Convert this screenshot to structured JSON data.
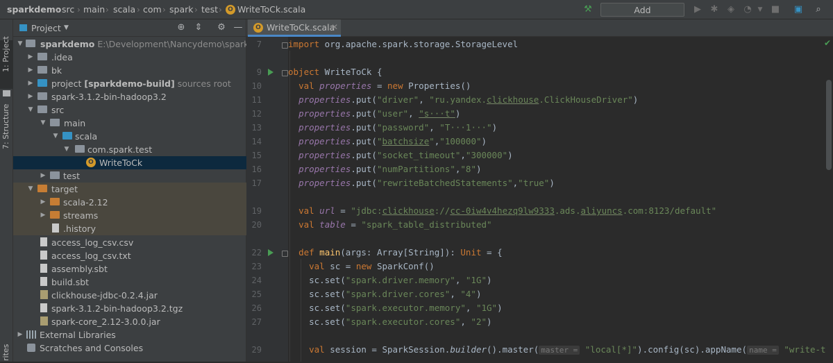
{
  "breadcrumbs": [
    "sparkdemo",
    "src",
    "main",
    "scala",
    "com",
    "spark",
    "test",
    "WriteToCk.scala"
  ],
  "toolbar": {
    "add_configuration": "Add Configuration..."
  },
  "left_strip": {
    "project_tab": "1: Project",
    "structure_tab": "7: Structure",
    "bottom_tab": "rites"
  },
  "project_panel": {
    "title": "Project",
    "tree": [
      {
        "label": "sparkdemo",
        "suffix": "E:\\Development\\Nancydemo\\sparkdemo",
        "icon": "module-folder-icon"
      },
      {
        "label": ".idea",
        "icon": "folder-icon"
      },
      {
        "label": "bk",
        "icon": "folder-icon"
      },
      {
        "label": "project",
        "bold": "[sparkdemo-build]",
        "suffix": "sources root",
        "icon": "blue-folder-icon"
      },
      {
        "label": "spark-3.1.2-bin-hadoop3.2",
        "icon": "folder-icon"
      },
      {
        "label": "src",
        "icon": "folder-icon"
      },
      {
        "label": "main",
        "icon": "folder-icon"
      },
      {
        "label": "scala",
        "icon": "blue-folder-icon"
      },
      {
        "label": "com.spark.test",
        "icon": "package-icon"
      },
      {
        "label": "WriteToCk",
        "icon": "scala-object-icon"
      },
      {
        "label": "test",
        "icon": "folder-icon"
      },
      {
        "label": "target",
        "icon": "excluded-folder-icon"
      },
      {
        "label": "scala-2.12",
        "icon": "excluded-folder-icon"
      },
      {
        "label": "streams",
        "icon": "excluded-folder-icon"
      },
      {
        "label": ".history",
        "icon": "file-icon"
      },
      {
        "label": "access_log_csv.csv",
        "icon": "file-icon"
      },
      {
        "label": "access_log_csv.txt",
        "icon": "file-icon"
      },
      {
        "label": "assembly.sbt",
        "icon": "file-icon"
      },
      {
        "label": "build.sbt",
        "icon": "file-icon"
      },
      {
        "label": "clickhouse-jdbc-0.2.4.jar",
        "icon": "jar-icon"
      },
      {
        "label": "spark-3.1.2-bin-hadoop3.2.tgz",
        "icon": "file-icon"
      },
      {
        "label": "spark-core_2.12-3.0.0.jar",
        "icon": "jar-icon"
      },
      {
        "label": "External Libraries",
        "icon": "library-icon"
      },
      {
        "label": "Scratches and Consoles",
        "icon": "scratches-icon"
      }
    ]
  },
  "editor": {
    "tab_label": "WriteToCk.scala",
    "line_numbers": [
      "7",
      "9",
      "10",
      "11",
      "12",
      "13",
      "14",
      "15",
      "16",
      "17",
      "19",
      "20",
      "22",
      "23",
      "24",
      "25",
      "26",
      "27",
      "29"
    ],
    "code": {
      "l7_import": "import",
      "l7_rest": " org.apache.spark.storage.StorageLevel",
      "l9_object": "object",
      "l9_name": " WriteToCk {",
      "val": "val",
      "new": "new",
      "l10_props": "properties",
      "l10_rest": " = ",
      "l10_ctor": " Properties()",
      "props": "properties",
      "put": ".put(",
      "l11_k": "\"driver\"",
      "l11_v1": "\"ru.yandex.",
      "l11_v2": "clickhouse",
      "l11_v3": ".ClickHouseDriver\"",
      "l12_k": "\"user\"",
      "l12_v": "\"s···t\"",
      "l13_k": "\"password\"",
      "l13_v": "\"T···1···\"",
      "l14_k1": "\"",
      "l14_k2": "batchsize",
      "l14_k3": "\"",
      "l14_v": "\"100000\"",
      "l15_k": "\"socket_timeout\"",
      "l15_v": "\"300000\"",
      "l16_k": "\"numPartitions\"",
      "l16_v": "\"8\"",
      "l17_k": "\"rewriteBatchedStatements\"",
      "l17_v": "\"true\"",
      "l19_name": "url",
      "l19_v1": "\"jdbc:",
      "l19_v2": "clickhouse",
      "l19_v3": "://",
      "l19_v4": "cc-0iw4v4hezq9lw9333",
      "l19_v5": ".ads.",
      "l19_v6": "aliyuncs",
      "l19_v7": ".com:8123/default\"",
      "l20_name": "table",
      "l20_v": "\"spark_table_distributed\"",
      "l22_def": "def",
      "l22_main": "main",
      "l22_args": "(args: Array[",
      "l22_string": "String",
      "l22_mid": "]): ",
      "l22_unit": "Unit",
      "l22_end": " = {",
      "l23_a": "sc = ",
      "l23_b": " SparkConf()",
      "l24_k": "\"spark.driver.memory\"",
      "l24_v": "\"1G\"",
      "l25_k": "\"spark.driver.cores\"",
      "l25_v": "\"4\"",
      "l26_k": "\"spark.executor.memory\"",
      "l26_v": "\"1G\"",
      "l27_k": "\"spark.executor.cores\"",
      "l27_v": "\"2\"",
      "scset": "sc.set(",
      "l29_a": "session = SparkSession.",
      "l29_builder": "builder",
      "l29_b": "().master(",
      "l29_hint1": "master =",
      "l29_v1": "\"local[*]\"",
      "l29_c": ").config(sc).appName(",
      "l29_hint2": "name =",
      "l29_v2": "\"write-t"
    }
  }
}
